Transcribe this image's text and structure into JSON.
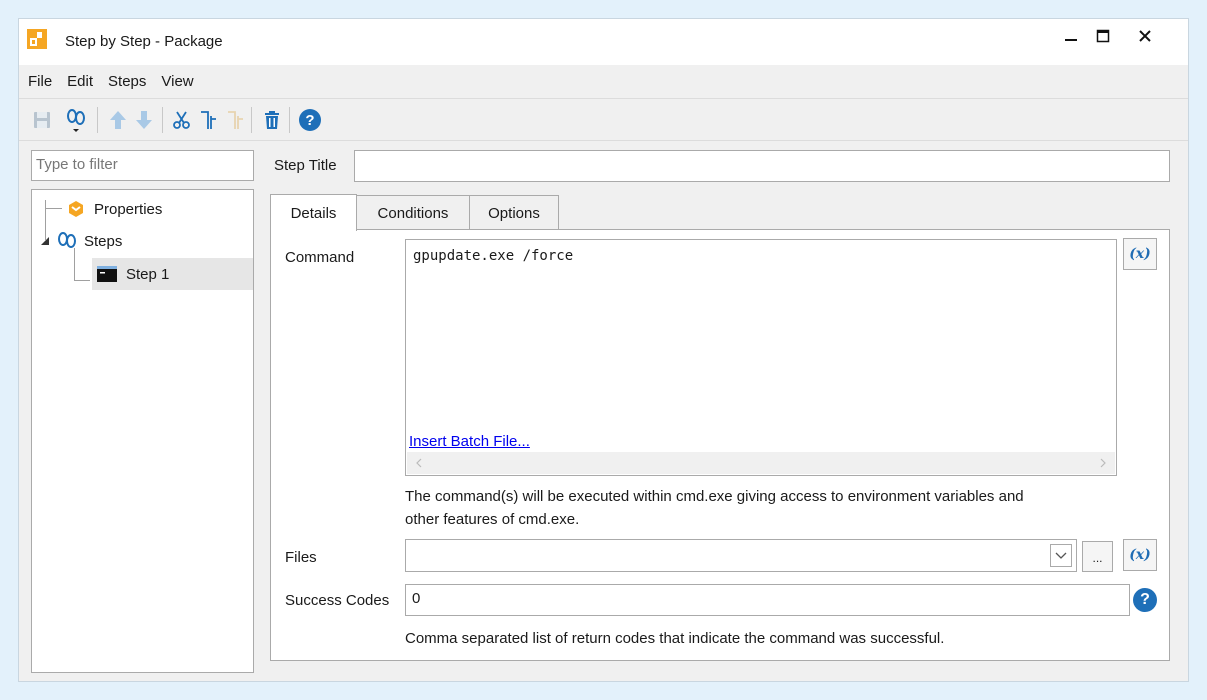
{
  "window": {
    "title": "Step by Step - Package"
  },
  "menu": [
    "File",
    "Edit",
    "Steps",
    "View"
  ],
  "toolbar": {
    "buttons": [
      "save-icon",
      "add-step-icon",
      "move-up-icon",
      "move-down-icon",
      "cut-icon",
      "copy-icon",
      "paste-icon",
      "delete-icon",
      "help-icon"
    ]
  },
  "filter": {
    "placeholder": "Type to filter"
  },
  "tree": {
    "properties": "Properties",
    "steps": "Steps",
    "step1": "Step 1"
  },
  "step_title": {
    "label": "Step Title",
    "value": ""
  },
  "tabs": [
    "Details",
    "Conditions",
    "Options"
  ],
  "details": {
    "command_label": "Command",
    "command_value": "gpupdate.exe /force",
    "insert_batch": "Insert Batch File...",
    "var_button": "(x)",
    "command_help": "The command(s) will be executed within cmd.exe giving access to environment variables and",
    "command_help2": "other features of cmd.exe.",
    "files_label": "Files",
    "files_value": "",
    "browse": "...",
    "success_label": "Success Codes",
    "success_value": "0",
    "success_help": "Comma separated list of return codes that indicate the command was successful."
  },
  "colors": {
    "accent": "#1e6fb8",
    "background": "#e3f1fb",
    "app_icon": "#f5a623"
  }
}
